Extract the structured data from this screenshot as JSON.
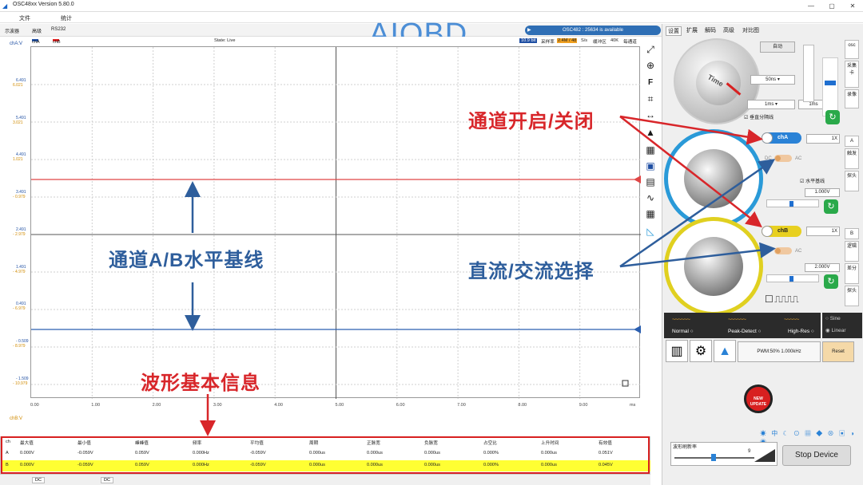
{
  "window": {
    "title": "OSC48xx  Version 5.80.0",
    "minimize": "—",
    "maximize": "▢",
    "close": "✕"
  },
  "menu": {
    "file": "文件",
    "stats": "统计"
  },
  "subbar": {
    "oscilloscope": "示波器",
    "advanced": "高级",
    "rs232": "RS232"
  },
  "watermark": "AIOBD",
  "status_pill": "OSC482 : 25634 is available",
  "infobar": {
    "cha": "chA",
    "chb": "chB",
    "state": "State: Live",
    "bits": "10.9 bit",
    "rate_label": "采样率",
    "rate_value": "2.4M / 48",
    "rate_unit": "S/s",
    "buffer_label": "缓冲区",
    "buffer_value": "40K",
    "channels_label": "每通道"
  },
  "axes": {
    "left_top_label": "chA:V",
    "left_bottom_label": "chB:V",
    "left_ticks": [
      {
        "a": "6.491",
        "b": "6.021"
      },
      {
        "a": "5.491",
        "b": "3.021"
      },
      {
        "a": "4.491",
        "b": "1.021"
      },
      {
        "a": "3.491",
        "b": "- 0.979"
      },
      {
        "a": "2.491",
        "b": "- 2.979"
      },
      {
        "a": "1.491",
        "b": "- 4.979"
      },
      {
        "a": "0.491",
        "b": "- 6.979"
      },
      {
        "a": "- 0.509",
        "b": "- 8.979"
      },
      {
        "a": "- 1.509",
        "b": "- 10.979"
      }
    ],
    "x_ticks": [
      "0.00",
      "1.00",
      "2.00",
      "3.00",
      "4.00",
      "5.00",
      "6.00",
      "7.00",
      "8.00",
      "9.00"
    ],
    "x_unit": "ms"
  },
  "colors": {
    "chA": "#1f4fa3",
    "chB": "#e02020",
    "chA_trace": "#2b5fb0",
    "chB_trace": "#e04646",
    "annotation_red": "#d8262a",
    "annotation_blue": "#2e5e9c",
    "highlight_yellow": "#ffff33"
  },
  "annotations": {
    "channel_toggle": "通道开启/关闭",
    "baseline": "通道A/B水平基线",
    "dc_ac": "直流/交流选择",
    "waveform_info": "波形基本信息"
  },
  "right_panel": {
    "tabs": [
      "设置",
      "扩展",
      "解码",
      "高级",
      "对比图"
    ],
    "auto_button": "自动",
    "timebase_select": "50ns",
    "time_start": "1ms",
    "time_end": "1ms",
    "vertical_divider": "垂直分隔线",
    "knob_time_label": "Time",
    "cha_button": "chA",
    "chb_button": "chB",
    "cha_probe": "1X",
    "chb_probe": "1X",
    "dc": "DC",
    "ac": "AC",
    "horizontal_baseline": "水平基线",
    "cha_offset": "1.000V",
    "chb_offset": "2.000V",
    "side_tabs_top": [
      "osc",
      "采集卡",
      "录像"
    ],
    "side_tabs_a": [
      "A",
      "触发",
      "探头"
    ],
    "side_tabs_b": [
      "B",
      "逻辑",
      "差分",
      "探头"
    ],
    "modes": {
      "normal": "Normal",
      "peak": "Peak-Detect",
      "highres": "High-Res",
      "sine": "Sine",
      "linear": "Linear"
    },
    "pwm": "PWM:50% 1.000kHz",
    "reset": "Reset",
    "new_update": "NEW UPDATE",
    "refresh_label": "波形刷新率",
    "refresh_value": "9",
    "stop_device": "Stop Device"
  },
  "measurements": {
    "headers": [
      "ch",
      "最大值",
      "最小值",
      "峰峰值",
      "频率",
      "平均值",
      "周期",
      "正脉宽",
      "负脉宽",
      "占空比",
      "上升时间",
      "有效值"
    ],
    "rows": [
      [
        "A",
        "0.000V",
        "-0.059V",
        "0.059V",
        "0.000Hz",
        "-0.059V",
        "0.000us",
        "0.000us",
        "0.000us",
        "0.000%",
        "0.000us",
        "0.051V"
      ],
      [
        "B",
        "0.000V",
        "-0.059V",
        "0.059V",
        "0.000Hz",
        "-0.059V",
        "0.000us",
        "0.000us",
        "0.000us",
        "0.000%",
        "0.000us",
        "0.045V"
      ]
    ]
  },
  "bottom_strip": {
    "cha_coupling": "DC",
    "chb_coupling": "DC"
  }
}
